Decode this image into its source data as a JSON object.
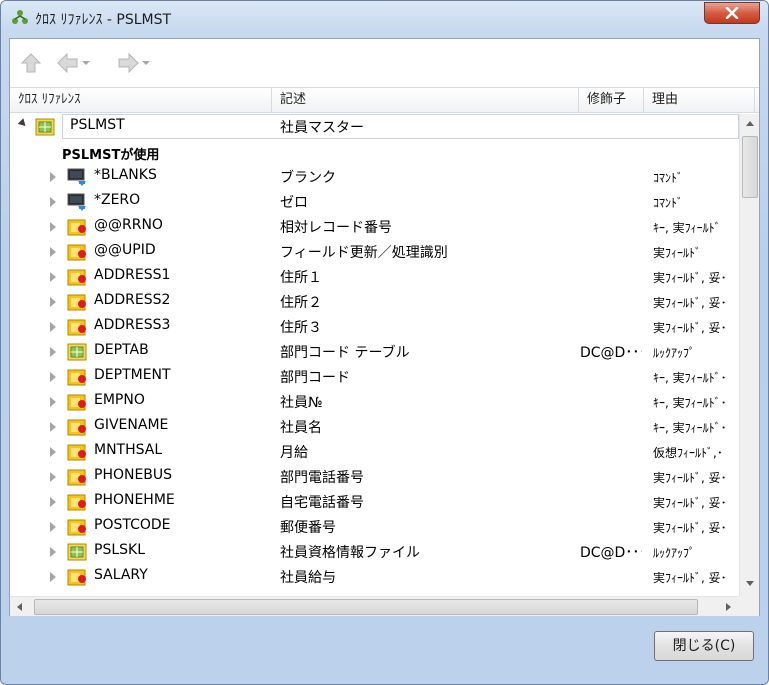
{
  "window": {
    "title": "ｸﾛｽ ﾘﾌｧﾚﾝｽ - PSLMST"
  },
  "toolbar": {
    "up": "up-arrow-icon",
    "back": "back-arrow-icon",
    "forward": "forward-arrow-icon"
  },
  "columns": [
    "ｸﾛｽ ﾘﾌｧﾚﾝｽ",
    "記述",
    "修飾子",
    "理由"
  ],
  "root": {
    "name": "PSLMST",
    "description": "社員マスター"
  },
  "group_label": "PSLMSTが使用",
  "items": [
    {
      "name": "*BLANKS",
      "description": "ブランク",
      "qualifier": "",
      "reason": "ｺﾏﾝﾄﾞ",
      "icon": "command-icon"
    },
    {
      "name": "*ZERO",
      "description": "ゼロ",
      "qualifier": "",
      "reason": "ｺﾏﾝﾄﾞ",
      "icon": "command-icon"
    },
    {
      "name": "@@RRNO",
      "description": "相対レコード番号",
      "qualifier": "",
      "reason": "ｷｰ, 実ﾌｨｰﾙﾄﾞ",
      "icon": "field-icon"
    },
    {
      "name": "@@UPID",
      "description": "フィールド更新／処理識別",
      "qualifier": "",
      "reason": "実ﾌｨｰﾙﾄﾞ",
      "icon": "field-icon"
    },
    {
      "name": "ADDRESS1",
      "description": "住所１",
      "qualifier": "",
      "reason": "実ﾌｨｰﾙﾄﾞ, 妥･",
      "icon": "field-icon"
    },
    {
      "name": "ADDRESS2",
      "description": "住所２",
      "qualifier": "",
      "reason": "実ﾌｨｰﾙﾄﾞ, 妥･",
      "icon": "field-icon"
    },
    {
      "name": "ADDRESS3",
      "description": "住所３",
      "qualifier": "",
      "reason": "実ﾌｨｰﾙﾄﾞ, 妥･",
      "icon": "field-icon"
    },
    {
      "name": "DEPTAB",
      "description": "部門コード テーブル",
      "qualifier": "DC@D･･･",
      "reason": "ﾙｯｸｱｯﾌﾟ",
      "icon": "file-icon"
    },
    {
      "name": "DEPTMENT",
      "description": "部門コード",
      "qualifier": "",
      "reason": "ｷｰ, 実ﾌｨｰﾙﾄﾞ･",
      "icon": "field-icon"
    },
    {
      "name": "EMPNO",
      "description": "社員№",
      "qualifier": "",
      "reason": "ｷｰ, 実ﾌｨｰﾙﾄﾞ･",
      "icon": "field-icon"
    },
    {
      "name": "GIVENAME",
      "description": "社員名",
      "qualifier": "",
      "reason": "ｷｰ, 実ﾌｨｰﾙﾄﾞ･",
      "icon": "field-icon"
    },
    {
      "name": "MNTHSAL",
      "description": "月給",
      "qualifier": "",
      "reason": "仮想ﾌｨｰﾙﾄﾞ,･",
      "icon": "field-icon"
    },
    {
      "name": "PHONEBUS",
      "description": "部門電話番号",
      "qualifier": "",
      "reason": "実ﾌｨｰﾙﾄﾞ, 妥･",
      "icon": "field-icon"
    },
    {
      "name": "PHONEHME",
      "description": "自宅電話番号",
      "qualifier": "",
      "reason": "実ﾌｨｰﾙﾄﾞ, 妥･",
      "icon": "field-icon"
    },
    {
      "name": "POSTCODE",
      "description": "郵便番号",
      "qualifier": "",
      "reason": "実ﾌｨｰﾙﾄﾞ, 妥･",
      "icon": "field-icon"
    },
    {
      "name": "PSLSKL",
      "description": "社員資格情報ファイル",
      "qualifier": "DC@D･･･",
      "reason": "ﾙｯｸｱｯﾌﾟ",
      "icon": "file-icon"
    },
    {
      "name": "SALARY",
      "description": "社員給与",
      "qualifier": "",
      "reason": "実ﾌｨｰﾙﾄﾞ, 妥･",
      "icon": "field-icon"
    }
  ],
  "buttons": {
    "close": "閉じる(C)"
  }
}
